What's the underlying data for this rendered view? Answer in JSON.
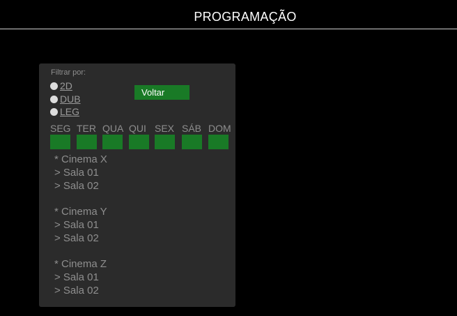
{
  "header": {
    "title": "PROGRAMAÇÃO"
  },
  "panel": {
    "filter_label": "Filtrar por:",
    "filters": [
      {
        "label": "2D"
      },
      {
        "label": "DUB"
      },
      {
        "label": "LEG"
      }
    ],
    "back_button_label": "Voltar",
    "days": [
      "SEG",
      "TER",
      "QUA",
      "QUI",
      "SEX",
      "SÁB",
      "DOM"
    ],
    "cinemas": [
      {
        "name": "* Cinema X",
        "rooms": [
          "> Sala 01",
          "> Sala 02"
        ]
      },
      {
        "name": "* Cinema Y",
        "rooms": [
          "> Sala 01",
          "> Sala 02"
        ]
      },
      {
        "name": "* Cinema Z",
        "rooms": [
          "> Sala 01",
          "> Sala 02"
        ]
      }
    ]
  },
  "colors": {
    "background": "#000000",
    "panel": "#2b2b2b",
    "accent_green": "#197a26",
    "text_muted": "#8e8e8e",
    "radio_dot": "#dcdcdc"
  },
  "icons": {
    "radio": "radio-dot-icon"
  }
}
